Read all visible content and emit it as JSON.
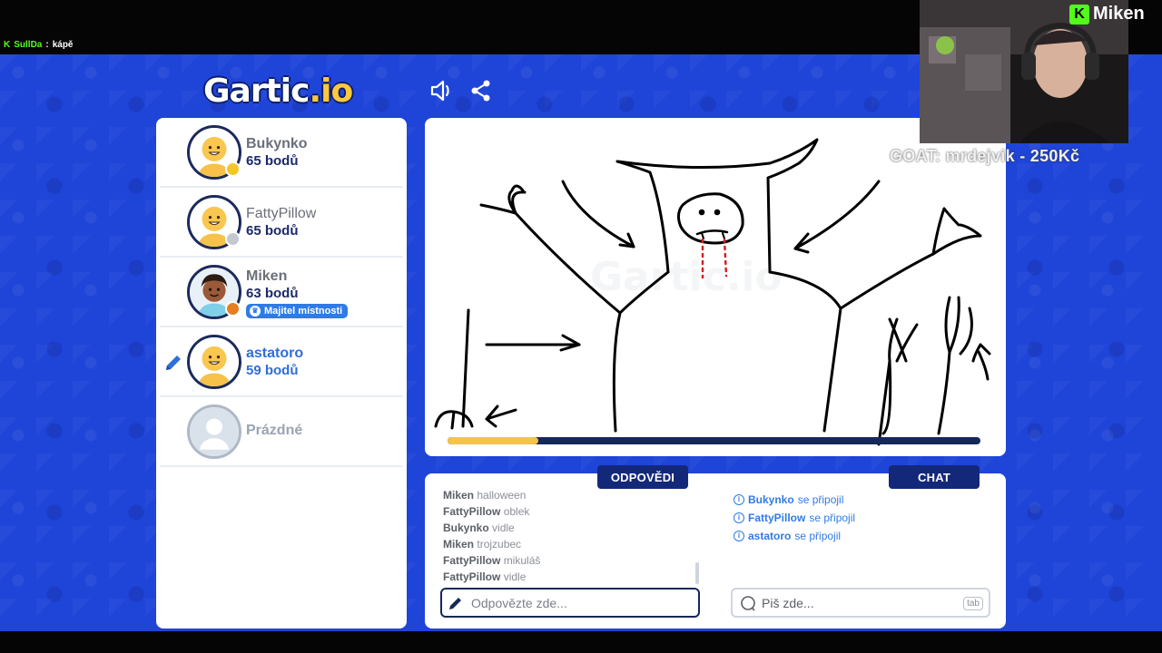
{
  "stream": {
    "chat_line": {
      "user": "SullDa",
      "text": "kápě"
    },
    "streamer_name": "Miken",
    "goal_text": "GOAT: mrdejvik - 250Kč"
  },
  "header": {
    "logo_main": "Gartic",
    "logo_suffix": ".io",
    "sound_icon": "speaker-icon",
    "share_icon": "share-icon"
  },
  "players": [
    {
      "name": "Bukynko",
      "score": "65 bodů",
      "status_color": "#f6c627",
      "drawing": false,
      "owner": false
    },
    {
      "name": "FattyPillow",
      "score": "65 bodů",
      "status_color": "#c4c9d1",
      "drawing": false,
      "owner": false
    },
    {
      "name": "Miken",
      "score": "63 bodů",
      "status_color": "#e67e22",
      "drawing": false,
      "owner": true,
      "owner_label": "Majitel místnosti"
    },
    {
      "name": "astatoro",
      "score": "59 bodů",
      "status_color": null,
      "drawing": true,
      "owner": false
    }
  ],
  "empty_slot": {
    "label": "Prázdné"
  },
  "canvas": {
    "watermark": "Gartic.io",
    "timer_progress": 0.17,
    "colors": {
      "ink": "#000000",
      "blood": "#d62020",
      "timer_fill": "#f3c34b",
      "timer_track": "#14285a"
    }
  },
  "answers_panel": {
    "title": "ODPOVĚDI",
    "messages": [
      {
        "user": "Miken",
        "text": "halloween"
      },
      {
        "user": "FattyPillow",
        "text": "oblek"
      },
      {
        "user": "Bukynko",
        "text": "vidle"
      },
      {
        "user": "Miken",
        "text": "trojzubec"
      },
      {
        "user": "FattyPillow",
        "text": "mikuláš"
      },
      {
        "user": "FattyPillow",
        "text": "vidle"
      }
    ],
    "input_placeholder": "Odpovězte zde..."
  },
  "chat_panel": {
    "title": "CHAT",
    "messages": [
      {
        "user": "Bukynko",
        "text": "se připojil"
      },
      {
        "user": "FattyPillow",
        "text": "se připojil"
      },
      {
        "user": "astatoro",
        "text": "se připojil"
      }
    ],
    "input_placeholder": "Piš zde...",
    "tab_hint": "tab"
  },
  "theme": {
    "background": "#1f44d8",
    "navy": "#14287a",
    "accent": "#2f7be6"
  }
}
